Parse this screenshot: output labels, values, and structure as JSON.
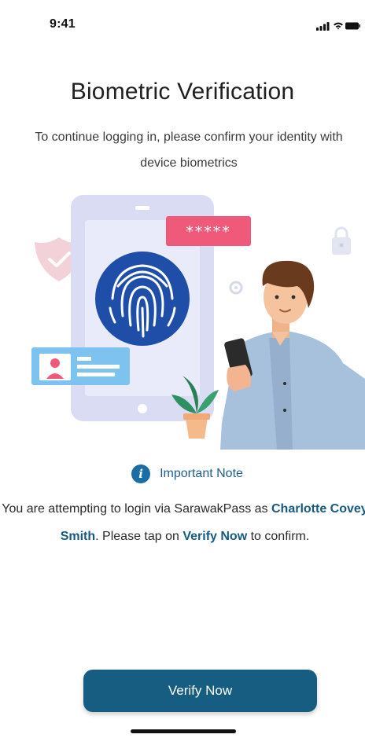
{
  "status_bar": {
    "time": "9:41"
  },
  "header": {
    "title": "Biometric Verification",
    "subtitle": "To continue logging in, please confirm your identity with device biometrics"
  },
  "illustration": {
    "password_mask": "*****"
  },
  "note": {
    "title": "Important Note",
    "text_1": "You are attempting to login via SarawakPass as ",
    "name": "Charlotte Covey Smith",
    "text_2": ". Please tap on ",
    "action": "Verify Now",
    "text_3": " to confirm."
  },
  "actions": {
    "verify_label": "Verify Now"
  },
  "colors": {
    "primary": "#175c81",
    "accent_text": "#155a82",
    "info_icon": "#1a6ea3"
  }
}
